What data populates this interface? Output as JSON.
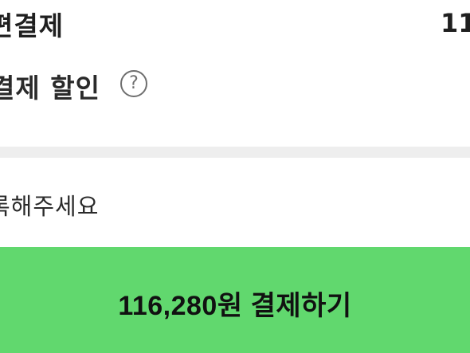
{
  "payment_method": {
    "label": "편결제",
    "amount_partial": "11"
  },
  "discount": {
    "label": "결제 할인",
    "help_glyph": "?"
  },
  "register_prompt": {
    "text": "록해주세요"
  },
  "checkout": {
    "button_label": "116,280원 결제하기",
    "button_color": "#61d86e"
  }
}
